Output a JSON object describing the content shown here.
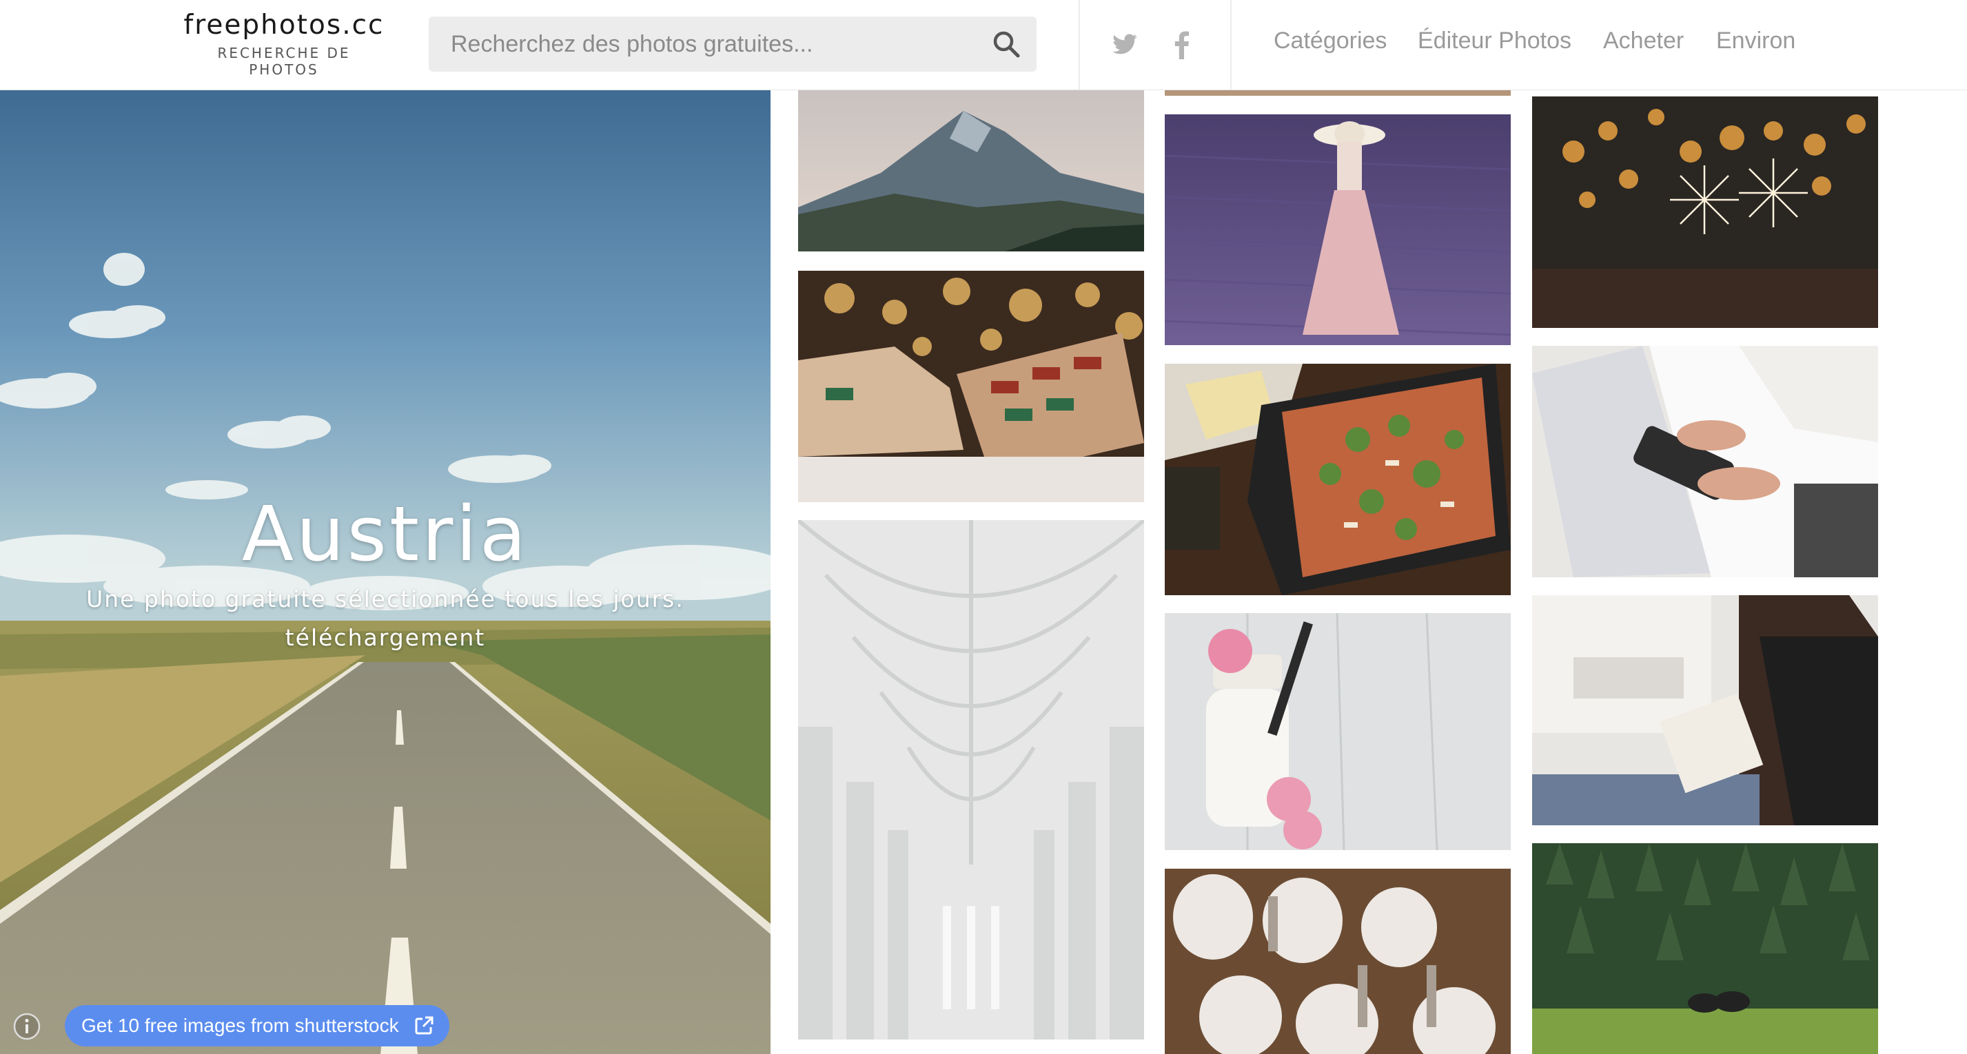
{
  "header": {
    "logo_title": "freephotos.cc",
    "logo_subtitle": "RECHERCHE DE PHOTOS",
    "search_placeholder": "Recherchez des photos gratuites...",
    "nav": [
      {
        "label": "Catégories"
      },
      {
        "label": "Éditeur Photos"
      },
      {
        "label": "Acheter"
      },
      {
        "label": "Environ"
      }
    ]
  },
  "hero": {
    "title": "Austria",
    "subtitle": "Une photo gratuite sélectionnée tous les jours.",
    "download": "téléchargement"
  },
  "promo": {
    "label": "Get 10 free images from shutterstock"
  },
  "colors": {
    "accent": "#5b8def",
    "nav_text": "#9a9a9a",
    "search_bg": "#ececec"
  },
  "icons": [
    "search-icon",
    "twitter-icon",
    "facebook-icon",
    "info-icon",
    "external-link-icon"
  ]
}
